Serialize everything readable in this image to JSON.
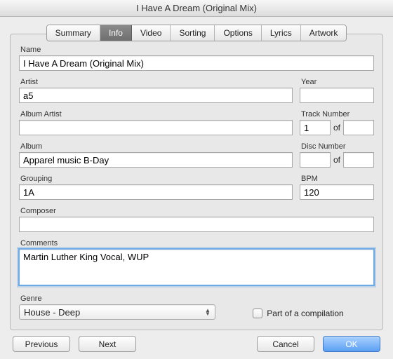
{
  "window": {
    "title": "I Have A Dream (Original Mix)"
  },
  "tabs": {
    "summary": "Summary",
    "info": "Info",
    "video": "Video",
    "sorting": "Sorting",
    "options": "Options",
    "lyrics": "Lyrics",
    "artwork": "Artwork",
    "active": "info"
  },
  "labels": {
    "name": "Name",
    "artist": "Artist",
    "year": "Year",
    "album_artist": "Album Artist",
    "track_number": "Track Number",
    "album": "Album",
    "disc_number": "Disc Number",
    "grouping": "Grouping",
    "bpm": "BPM",
    "composer": "Composer",
    "comments": "Comments",
    "genre": "Genre",
    "of": "of",
    "compilation": "Part of a compilation"
  },
  "values": {
    "name": "I Have A Dream (Original Mix)",
    "artist": "a5",
    "year": "",
    "album_artist": "",
    "track_number": "1",
    "track_total": "",
    "album": "Apparel music B-Day",
    "disc_number": "",
    "disc_total": "",
    "grouping": "1A",
    "bpm": "120",
    "composer": "",
    "comments": "Martin Luther King Vocal, WUP",
    "genre": "House - Deep",
    "compilation_checked": false
  },
  "buttons": {
    "previous": "Previous",
    "next": "Next",
    "cancel": "Cancel",
    "ok": "OK"
  }
}
